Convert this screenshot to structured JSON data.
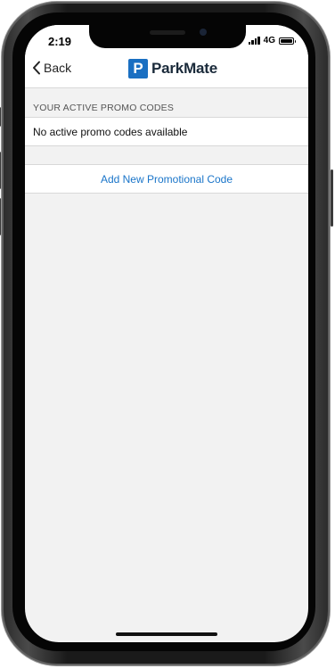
{
  "status_bar": {
    "time": "2:19",
    "network": "4G",
    "signal_bars": 4,
    "battery_level": 1.0
  },
  "nav": {
    "back_label": "Back",
    "logo_letter": "P",
    "app_name": "ParkMate"
  },
  "promo": {
    "section_header": "YOUR ACTIVE PROMO CODES",
    "empty_message": "No active promo codes available",
    "add_button_label": "Add New Promotional Code"
  },
  "colors": {
    "brand_blue": "#1a6fc2",
    "link_blue": "#1a75c9",
    "screen_background": "#f2f2f2"
  },
  "icons": {
    "back": "chevron-left-icon",
    "signal": "cellular-signal-icon",
    "battery": "battery-icon"
  }
}
